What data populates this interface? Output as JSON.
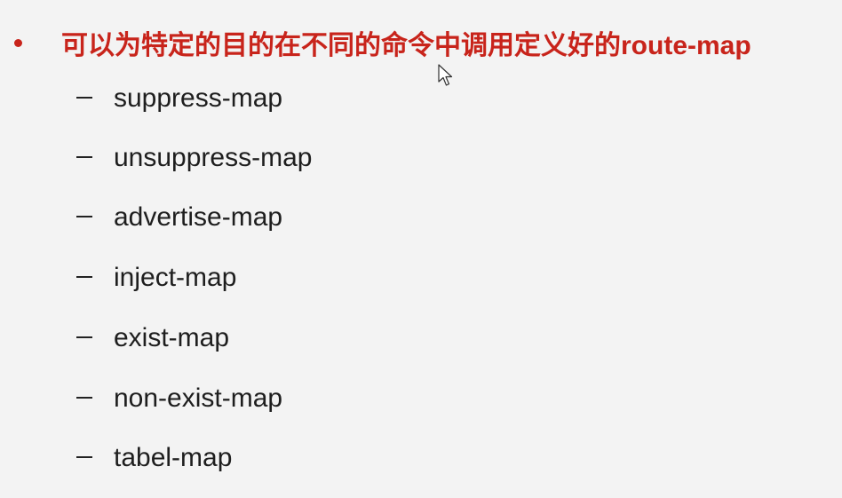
{
  "heading": "可以为特定的目的在不同的命令中调用定义好的route-map",
  "items": [
    "suppress-map",
    "unsuppress-map",
    "advertise-map",
    "inject-map",
    "exist-map",
    "non-exist-map",
    "tabel-map"
  ],
  "colors": {
    "heading": "#c8241b",
    "text": "#1e1e1e",
    "background": "#f3f3f3"
  },
  "icons": {
    "bullet": "bullet-dot-icon",
    "dash": "dash-icon",
    "cursor": "mouse-pointer-icon"
  }
}
